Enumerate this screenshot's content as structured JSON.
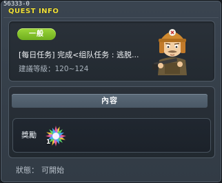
{
  "window": {
    "quest_id": "56333-0",
    "title": "QUEST INFO"
  },
  "quest": {
    "category_badge": "一般",
    "name": "[每日任务] 完成<组队任务 : 逃脱...",
    "level_label": "建議等級：",
    "level_range": "120~124",
    "npc_icon": "soldier-npc-portrait"
  },
  "content": {
    "header": "內容",
    "reward_label": "獎勵",
    "reward_item_icon": "rainbow-crystal-icon",
    "reward_item_qty": "1"
  },
  "status": {
    "label": "狀態：",
    "value": "可開始"
  },
  "colors": {
    "title": "#f2e23a",
    "badge": "#8fcf2f",
    "window_bg": "#36404b"
  }
}
